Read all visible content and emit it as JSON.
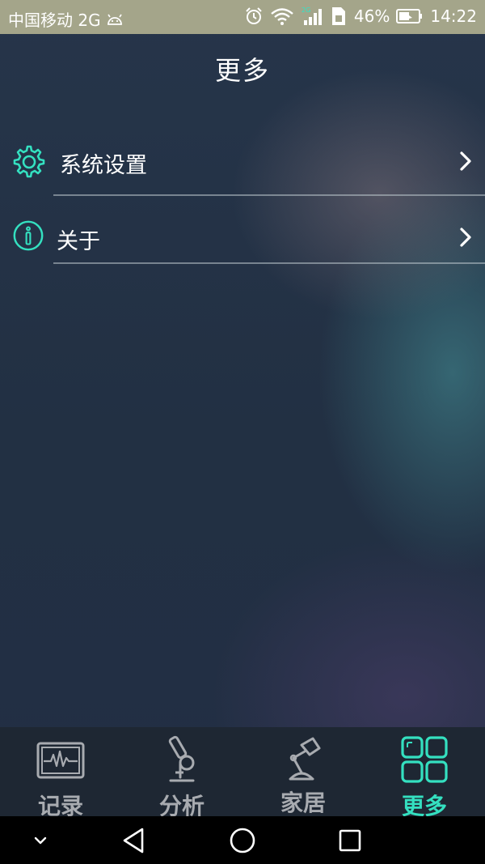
{
  "status_bar": {
    "carrier": "中国移动 2G",
    "battery_percent": "46%",
    "time": "14:22",
    "icons": [
      "android-icon",
      "alarm-icon",
      "wifi-icon",
      "signal-icon",
      "sim-icon",
      "battery-icon"
    ]
  },
  "header": {
    "title": "更多"
  },
  "menu": {
    "items": [
      {
        "label": "系统设置",
        "icon": "gear-icon"
      },
      {
        "label": "关于",
        "icon": "info-icon"
      }
    ]
  },
  "tabbar": {
    "tabs": [
      {
        "label": "记录",
        "icon": "monitor-icon",
        "active": false
      },
      {
        "label": "分析",
        "icon": "microscope-icon",
        "active": false
      },
      {
        "label": "家居",
        "icon": "lamp-icon",
        "active": false
      },
      {
        "label": "更多",
        "icon": "grid-icon",
        "active": true
      }
    ]
  },
  "navbar": {
    "icons": [
      "collapse-icon",
      "back-icon",
      "home-icon",
      "recents-icon"
    ]
  },
  "colors": {
    "accent": "#34e0c0",
    "status_bar": "#a4a58a",
    "tabbar": "#1e2733",
    "inactive": "#a8abb0"
  }
}
